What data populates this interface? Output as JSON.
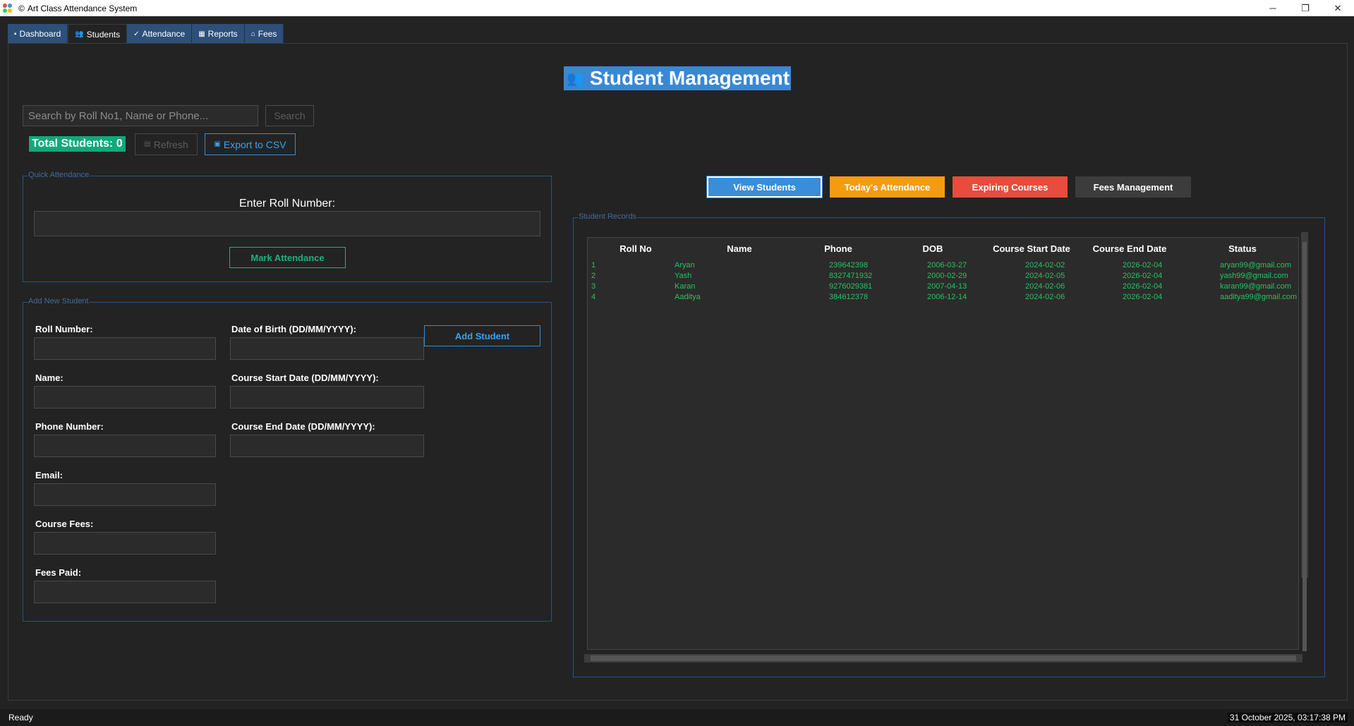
{
  "window": {
    "title": "Art Class Attendance System",
    "title_glyph": "©",
    "minimize": "─",
    "maximize": "❐",
    "close": "✕"
  },
  "tabs": [
    {
      "icon": "▪",
      "label": "Dashboard"
    },
    {
      "icon": "👥",
      "label": "Students"
    },
    {
      "icon": "✓",
      "label": "Attendance"
    },
    {
      "icon": "▦",
      "label": "Reports"
    },
    {
      "icon": "⌂",
      "label": "Fees"
    }
  ],
  "active_tab": "Students",
  "page_title": {
    "icon": "👥",
    "text": "Student Management"
  },
  "search": {
    "placeholder": "Search by Roll No1, Name or Phone...",
    "button": "Search"
  },
  "total_students": "Total Students: 0",
  "refresh": {
    "icon": "▤",
    "label": "Refresh"
  },
  "export": {
    "icon": "▣",
    "label": "Export to CSV"
  },
  "quick_attendance": {
    "group_label": "Quick Attendance",
    "prompt": "Enter Roll Number:",
    "button": "Mark Attendance"
  },
  "add_student": {
    "group_label": "Add New Student",
    "fields": [
      {
        "label": "Roll Number:"
      },
      {
        "label": "Name:"
      },
      {
        "label": "Phone Number:"
      },
      {
        "label": "Email:"
      },
      {
        "label": "Course Fees:"
      },
      {
        "label": "Fees Paid:"
      },
      {
        "label": "Date of Birth (DD/MM/YYYY):"
      },
      {
        "label": "Course Start Date (DD/MM/YYYY):"
      },
      {
        "label": "Course End Date (DD/MM/YYYY):"
      }
    ],
    "button": "Add Student"
  },
  "filters": [
    "View Students",
    "Today's Attendance",
    "Expiring Courses",
    "Fees Management"
  ],
  "filter_colors": {
    "view": "#3a8ed8",
    "today": "#f39c12",
    "expiring": "#e74c3c",
    "fees": "#3c3c3c"
  },
  "records": {
    "group_label": "Student Records",
    "columns": [
      "Roll No",
      "Name",
      "Phone",
      "DOB",
      "Course Start Date",
      "Course End Date",
      "Status"
    ],
    "rows": [
      [
        "1",
        "Aryan",
        "239642398",
        "2006-03-27",
        "2024-02-02",
        "2026-02-04",
        "aryan99@gmail.com"
      ],
      [
        "2",
        "Yash",
        "8327471932",
        "2000-02-29",
        "2024-02-05",
        "2026-02-04",
        "yash99@gmail.com"
      ],
      [
        "3",
        "Karan",
        "9276029381",
        "2007-04-13",
        "2024-02-06",
        "2026-02-04",
        "karan99@gmail.com"
      ],
      [
        "4",
        "Aaditya",
        "384612378",
        "2006-12-14",
        "2024-02-06",
        "2026-02-04",
        "aaditya99@gmail.com"
      ]
    ]
  },
  "status": {
    "left": "Ready",
    "right": "31 October 2025, 03:17:38 PM"
  }
}
